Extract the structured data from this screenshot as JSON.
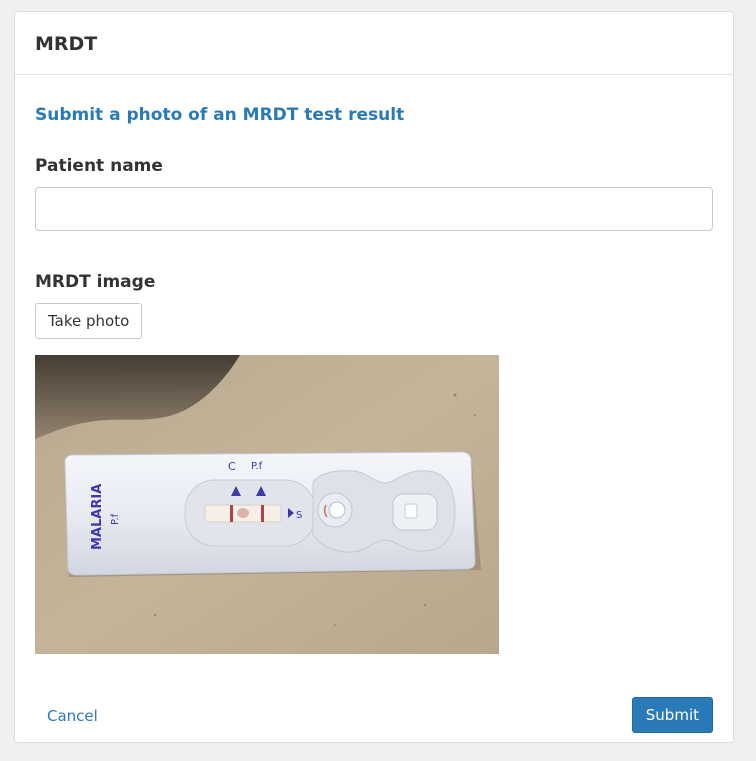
{
  "panel": {
    "title": "MRDT"
  },
  "form": {
    "heading": "Submit a photo of an MRDT test result",
    "patient_name": {
      "label": "Patient name",
      "value": "",
      "placeholder": ""
    },
    "image": {
      "label": "MRDT image",
      "take_photo_label": "Take photo",
      "photo_text": {
        "brand": "MALARIA",
        "sub": "P.f",
        "control": "C",
        "test": "P.f",
        "sample": "S"
      }
    }
  },
  "footer": {
    "cancel_label": "Cancel",
    "submit_label": "Submit"
  },
  "colors": {
    "accent": "#2a7ab8",
    "background": "#f0f0f0"
  }
}
